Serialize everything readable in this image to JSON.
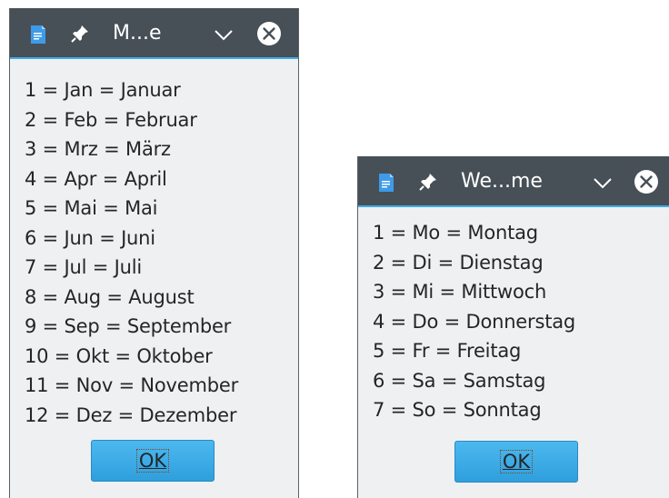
{
  "months_window": {
    "title": "M...e",
    "lines": [
      "1 = Jan = Januar",
      "2 = Feb = Februar",
      "3 = Mrz = März",
      "4 = Apr = April",
      "5 = Mai = Mai",
      "6 = Jun = Juni",
      "7 = Jul = Juli",
      "8 = Aug = August",
      "9 = Sep = September",
      "10 = Okt = Oktober",
      "11 = Nov = November",
      "12 = Dez = Dezember"
    ],
    "ok_label": "OK"
  },
  "days_window": {
    "title": "We...me",
    "lines": [
      "1 = Mo = Montag",
      "2 = Di = Dienstag",
      "3 = Mi = Mittwoch",
      "4 = Do = Donnerstag",
      "5 = Fr = Freitag",
      "6 = Sa = Samstag",
      "7 = So = Sonntag"
    ],
    "ok_label": "OK"
  },
  "icons": {
    "app": "document-app-icon",
    "pin": "pin-icon",
    "chevron": "chevron-down-icon",
    "close": "close-icon"
  },
  "colors": {
    "titlebar": "#475057",
    "accent": "#3daee9",
    "window_bg": "#eff0f1",
    "button": "#3daee9",
    "text": "#232627"
  }
}
